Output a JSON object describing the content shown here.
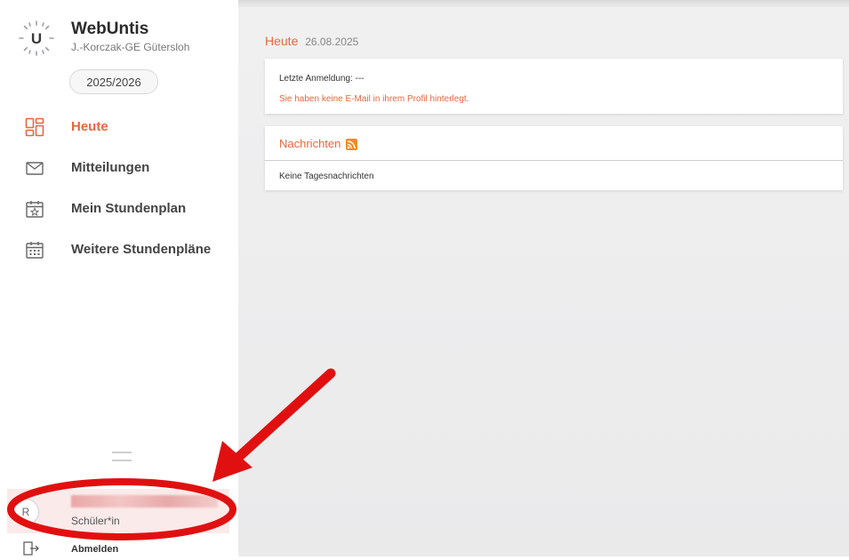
{
  "sidebar": {
    "app_title": "WebUntis",
    "school": "J.-Korczak-GE Gütersloh",
    "school_year": "2025/2026",
    "nav": [
      {
        "label": "Heute",
        "icon": "dashboard-icon",
        "active": true
      },
      {
        "label": "Mitteilungen",
        "icon": "envelope-icon",
        "active": false
      },
      {
        "label": "Mein Stundenplan",
        "icon": "calendar-star-icon",
        "active": false
      },
      {
        "label": "Weitere Stundenpläne",
        "icon": "calendar-grid-icon",
        "active": false
      }
    ],
    "user": {
      "avatar_initial": "R",
      "role": "Schüler*in"
    },
    "logout_label": "Abmelden"
  },
  "main": {
    "title": "Heute",
    "date": "26.08.2025",
    "login_card": {
      "last_login": "Letzte Anmeldung: ---",
      "warning": "Sie haben keine E-Mail in ihrem Profil hinterlegt."
    },
    "news_card": {
      "title": "Nachrichten",
      "empty_text": "Keine Tagesnachrichten"
    }
  },
  "colors": {
    "accent": "#e8663d",
    "annotation_red": "#e11010",
    "rss": "#f28b22"
  }
}
